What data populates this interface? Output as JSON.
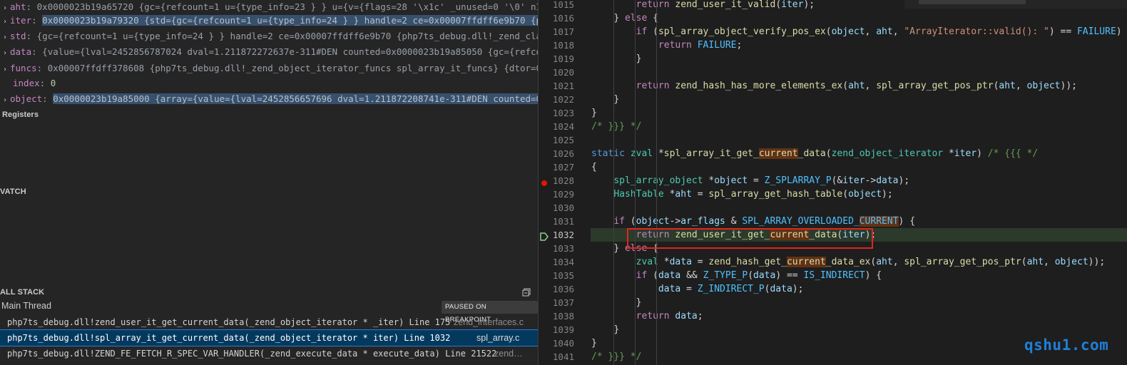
{
  "variables": [
    {
      "tw": "›",
      "name": "aht",
      "sep": ": ",
      "value": "0x0000023b19a65720 {gc={refcount=1 u={type_info=23 } } u={v={flags=28 '\\x1c' _unused=0 '\\0' nItera…",
      "hl": false,
      "indent": 0
    },
    {
      "tw": "›",
      "name": "iter",
      "sep": ": ",
      "value": "0x0000023b19a79320 {std={gc={refcount=1 u={type_info=24 } } handle=2 ce=0x00007ffdff6e9b70 {php7t…",
      "hl": true,
      "indent": 0
    },
    {
      "tw": "›",
      "name": "std",
      "sep": ": ",
      "value": "{gc={refcount=1 u={type_info=24 } } handle=2 ce=0x00007ffdff6e9b70 {php7ts_debug.dll!_zend_class_…",
      "hl": false,
      "indent": 0
    },
    {
      "tw": "›",
      "name": "data",
      "sep": ": ",
      "value": "{value={lval=2452856787024 dval=1.211872272637e-311#DEN counted=0x0000023b19a85050 {gc={refcount…",
      "hl": false,
      "indent": 0
    },
    {
      "tw": "›",
      "name": "funcs",
      "sep": ": ",
      "value": "0x00007ffdff378608 {php7ts_debug.dll!_zend_object_iterator_funcs spl_array_it_funcs} {dtor=0x00…",
      "hl": false,
      "indent": 0
    },
    {
      "tw": "",
      "name": "index",
      "sep": ": ",
      "value": "0",
      "hl": false,
      "indent": 1
    },
    {
      "tw": "›",
      "name": "object",
      "sep": ": ",
      "value": "0x0000023b19a85000 {array={value={lval=2452856657696 dval=1.211872208741e-311#DEN counted=0x000…",
      "hl": true,
      "indent": 0
    }
  ],
  "sections": {
    "registers": "Registers",
    "watch": "VATCH",
    "call_stack": "ALL STACK"
  },
  "call_stack": {
    "thread": "Main Thread",
    "paused": "PAUSED ON BREAKPOINT",
    "frames": [
      {
        "fn": "php7ts_debug.dll!zend_user_it_get_current_data(_zend_object_iterator * _iter) Line 175",
        "file": "zend_interfaces.c",
        "selected": false
      },
      {
        "fn": "php7ts_debug.dll!spl_array_it_get_current_data(_zend_object_iterator * iter) Line 1032",
        "file": "spl_array.c",
        "selected": true
      },
      {
        "fn": "php7ts_debug.dll!ZEND_FE_FETCH_R_SPEC_VAR_HANDLER(_zend_execute_data * execute_data) Line 21522",
        "file": "zend…",
        "selected": false
      }
    ]
  },
  "editor": {
    "breakpoint_line": "1028",
    "current_line": "1032",
    "lines": [
      {
        "n": "1015",
        "t": "        return zend_user_it_valid(iter);"
      },
      {
        "n": "1016",
        "t": "    } else {"
      },
      {
        "n": "1017",
        "t": "        if (spl_array_object_verify_pos_ex(object, aht, \"ArrayIterator::valid(): \") == FAILURE) {"
      },
      {
        "n": "1018",
        "t": "            return FAILURE;"
      },
      {
        "n": "1019",
        "t": "        }"
      },
      {
        "n": "1020",
        "t": ""
      },
      {
        "n": "1021",
        "t": "        return zend_hash_has_more_elements_ex(aht, spl_array_get_pos_ptr(aht, object));"
      },
      {
        "n": "1022",
        "t": "    }"
      },
      {
        "n": "1023",
        "t": "}"
      },
      {
        "n": "1024",
        "t": "/* }}} */"
      },
      {
        "n": "1025",
        "t": ""
      },
      {
        "n": "1026",
        "t": "static zval *spl_array_it_get_current_data(zend_object_iterator *iter) /* {{{ */"
      },
      {
        "n": "1027",
        "t": "{"
      },
      {
        "n": "1028",
        "t": "    spl_array_object *object = Z_SPLARRAY_P(&iter->data);"
      },
      {
        "n": "1029",
        "t": "    HashTable *aht = spl_array_get_hash_table(object);"
      },
      {
        "n": "1030",
        "t": ""
      },
      {
        "n": "1031",
        "t": "    if (object->ar_flags & SPL_ARRAY_OVERLOADED_CURRENT) {"
      },
      {
        "n": "1032",
        "t": "        return zend_user_it_get_current_data(iter);"
      },
      {
        "n": "1033",
        "t": "    } else {"
      },
      {
        "n": "1034",
        "t": "        zval *data = zend_hash_get_current_data_ex(aht, spl_array_get_pos_ptr(aht, object));"
      },
      {
        "n": "1035",
        "t": "        if (data && Z_TYPE_P(data) == IS_INDIRECT) {"
      },
      {
        "n": "1036",
        "t": "            data = Z_INDIRECT_P(data);"
      },
      {
        "n": "1037",
        "t": "        }"
      },
      {
        "n": "1038",
        "t": "        return data;"
      },
      {
        "n": "1039",
        "t": "    }"
      },
      {
        "n": "1040",
        "t": "}"
      },
      {
        "n": "1041",
        "t": "/* }}} */"
      }
    ]
  },
  "watermark": "qshu1.com",
  "colors": {
    "breakpoint": "#e51400",
    "highlight_box": "#e0261d",
    "selection": "#04395e",
    "watermark": "#1e7fd8"
  }
}
